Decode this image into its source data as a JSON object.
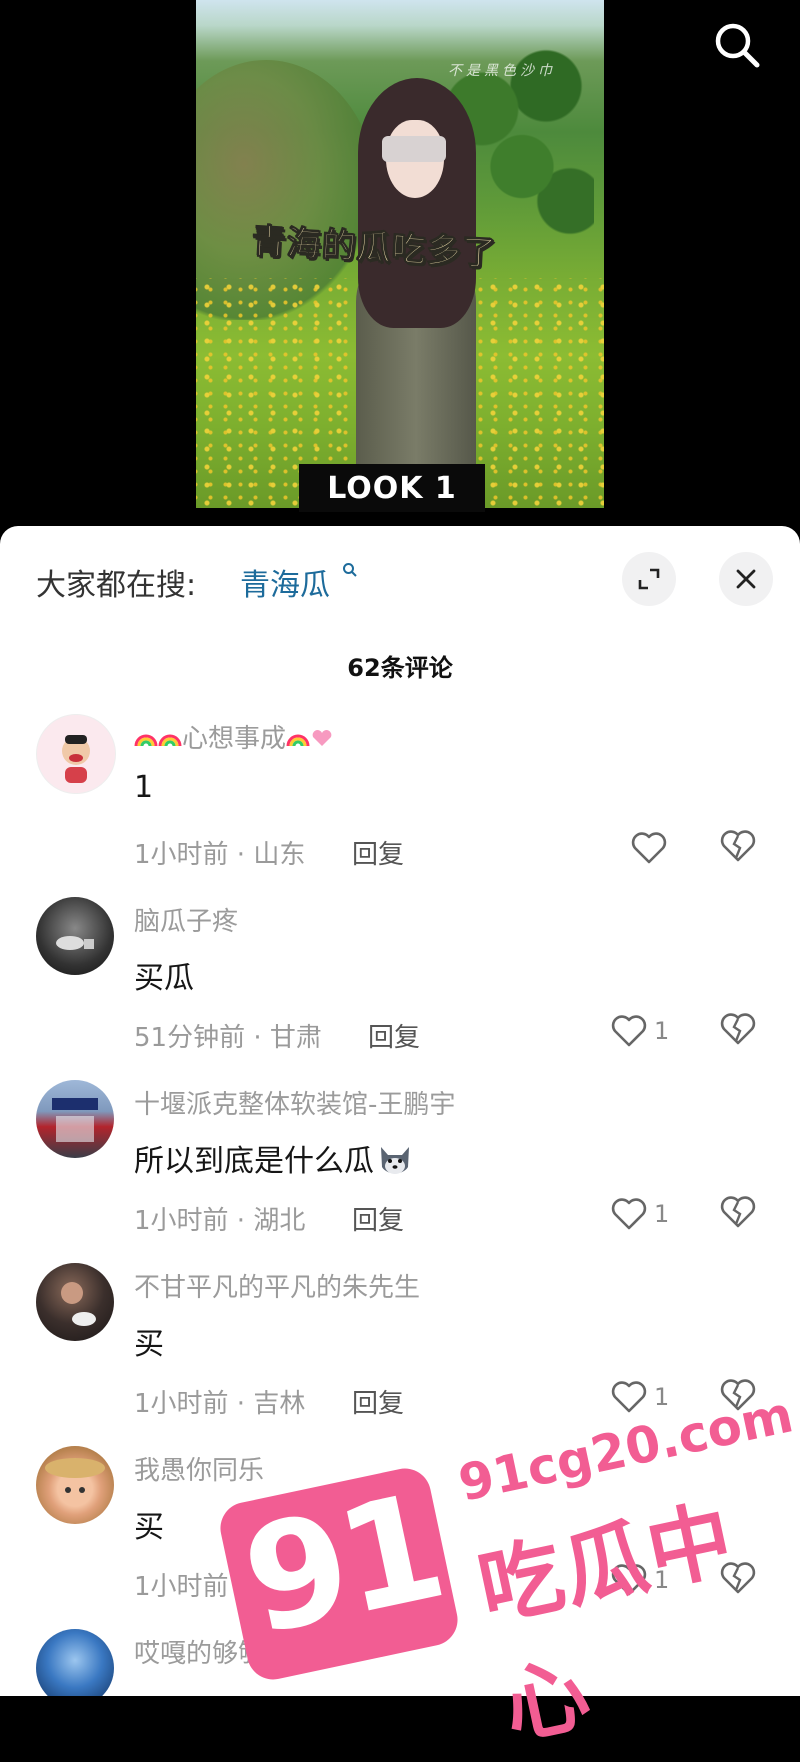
{
  "video": {
    "caption": "青海的瓜吃多了",
    "badge": "LOOK 1",
    "watermark": "不是黑色沙巾"
  },
  "sheet": {
    "hot_search_label": "大家都在搜:",
    "hot_search_term": "青海瓜",
    "comment_count": "62条评论"
  },
  "comments": [
    {
      "name": "心想事成",
      "text": "1",
      "meta": "1小时前 · 山东",
      "reply": "回复",
      "likes": ""
    },
    {
      "name": "脑瓜子疼",
      "text": "买瓜",
      "meta": "51分钟前 · 甘肃",
      "reply": "回复",
      "likes": "1"
    },
    {
      "name": "十堰派克整体软装馆-王鹏宇",
      "text": "所以到底是什么瓜",
      "meta": "1小时前 · 湖北",
      "reply": "回复",
      "likes": "1"
    },
    {
      "name": "不甘平凡的平凡的朱先生",
      "text": "买",
      "meta": "1小时前 · 吉林",
      "reply": "回复",
      "likes": "1"
    },
    {
      "name": "我愚你同乐",
      "text": "买",
      "meta": "1小时前 · 湖北",
      "reply": "回复",
      "likes": "1"
    },
    {
      "name": "哎嘎的够够的",
      "text": "",
      "meta": "",
      "reply": "",
      "likes": ""
    }
  ],
  "site_watermark": {
    "badge": "91",
    "url": "91cg20.com",
    "name": "吃瓜中心"
  },
  "colors": {
    "accent_link": "#1d6b9b",
    "watermark_pink": "#f25d93"
  }
}
